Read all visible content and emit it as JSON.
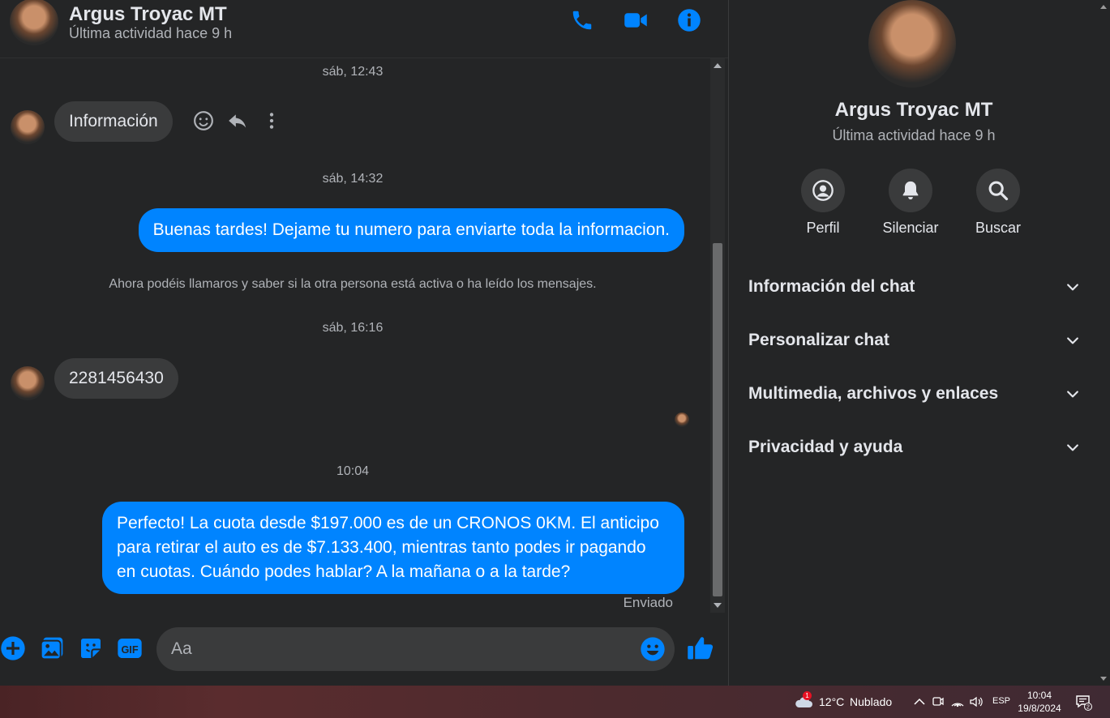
{
  "header": {
    "name": "Argus Troyac MT",
    "status": "Última actividad hace 9 h",
    "icons": [
      "phone-icon",
      "video-icon",
      "info-icon"
    ]
  },
  "messages": {
    "stamps": [
      "sáb, 12:43",
      "sáb, 14:32",
      "sáb, 16:16",
      "10:04"
    ],
    "incoming_1": "Información",
    "outgoing_1": "Buenas tardes! Dejame tu numero para enviarte toda la informacion.",
    "notice": "Ahora podéis llamaros y saber si la otra persona está activa o ha leído los mensajes.",
    "incoming_2": "2281456430",
    "outgoing_2_lines": [
      "Perfecto! La cuota desde $197.000 es de un CRONOS 0KM. El anticipo",
      "para retirar el auto es de $7.133.400, mientras tanto podes ir pagando",
      "en cuotas. Cuándo podes hablar? A la mañana o a la tarde?"
    ],
    "sent_status": "Enviado"
  },
  "composer": {
    "placeholder": "Aa",
    "icons": [
      "add-icon",
      "image-icon",
      "sticker-icon",
      "gif-icon",
      "emoji-icon",
      "like-icon"
    ]
  },
  "side": {
    "name": "Argus Troyac MT",
    "status": "Última actividad hace 9 h",
    "actions": [
      "Perfil",
      "Silenciar",
      "Buscar"
    ],
    "sections": [
      "Información del chat",
      "Personalizar chat",
      "Multimedia, archivos y enlaces",
      "Privacidad y ayuda"
    ]
  },
  "taskbar": {
    "weather_temp": "12°C",
    "weather_desc": "Nublado",
    "weather_badge": "1",
    "language": "ESP",
    "time": "10:04",
    "date": "19/8/2024",
    "notification_count": "2"
  },
  "colors": {
    "accent": "#0084ff",
    "background": "#242526",
    "bubble_in": "#3a3b3c"
  }
}
